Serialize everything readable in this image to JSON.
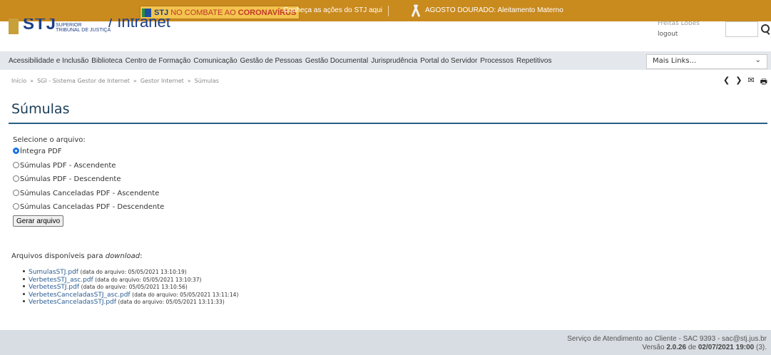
{
  "banner": {
    "badge_stj": "STJ",
    "badge_mid": "NO COMBATE AO",
    "badge_virus": "CORONAVÍRUS",
    "link": "Conheça as ações do STJ aqui",
    "agosto": "AGOSTO DOURADO: Aleitamento Materno",
    "colors": {
      "background": "#c98a1e",
      "badge": "#f3c44e"
    }
  },
  "header": {
    "logo_stj": "STJ",
    "logo_sub_line1": "SUPERIOR",
    "logo_sub_line2": "TRIBUNAL DE JUSTIÇA",
    "logo_suffix": "/ Intranet",
    "user_name": "Freitas Lopes",
    "logout": "logout"
  },
  "nav": {
    "items": [
      "Acessibilidade e Inclusão",
      "Biblioteca",
      "Centro de Formação",
      "Comunicação",
      "Gestão de Pessoas",
      "Gestão Documental",
      "Jurisprudência",
      "Portal do Servidor",
      "Processos",
      "Repetitivos"
    ],
    "mais_links": "Mais Links..."
  },
  "breadcrumb": [
    "Início",
    "SGI - Sistema Gestor de Internet",
    "Gestor Internet",
    "Súmulas"
  ],
  "breadcrumb_sep": "»",
  "tools": {
    "prev": "❮",
    "next": "❯",
    "email": "✉",
    "print": "🖶"
  },
  "page": {
    "title": "Súmulas",
    "select_label": "Selecione o arquivo:",
    "options": [
      "Íntegra PDF",
      "Súmulas PDF - Ascendente",
      "Súmulas PDF - Descendente",
      "Súmulas Canceladas PDF - Ascendente",
      "Súmulas Canceladas PDF - Descendente"
    ],
    "selected_option": "Íntegra PDF",
    "generate_button": "Gerar arquivo",
    "downloads_prefix": "Arquivos disponíveis para ",
    "downloads_italic": "download",
    "downloads_suffix": ":",
    "files": [
      {
        "name": "SumulasSTJ.pdf",
        "date": "(data do arquivo: 05/05/2021 13:10:19)"
      },
      {
        "name": "VerbetesSTJ_asc.pdf",
        "date": "(data do arquivo: 05/05/2021 13:10:37)"
      },
      {
        "name": "VerbetesSTJ.pdf",
        "date": "(data do arquivo: 05/05/2021 13:10:56)"
      },
      {
        "name": "VerbetesCanceladasSTJ_asc.pdf",
        "date": "(data do arquivo: 05/05/2021 13:11:14)"
      },
      {
        "name": "VerbetesCanceladasSTJ.pdf",
        "date": "(data do arquivo: 05/05/2021 13:11:33)"
      }
    ]
  },
  "footer": {
    "line1": "Serviço de Atendimento ao Cliente - SAC 9393 - sac@stj.jus.br",
    "version_prefix": "Versão ",
    "version": "2.0.26",
    "version_mid": " de ",
    "version_date": "02/07/2021 19:00",
    "version_suffix": " (3)."
  }
}
